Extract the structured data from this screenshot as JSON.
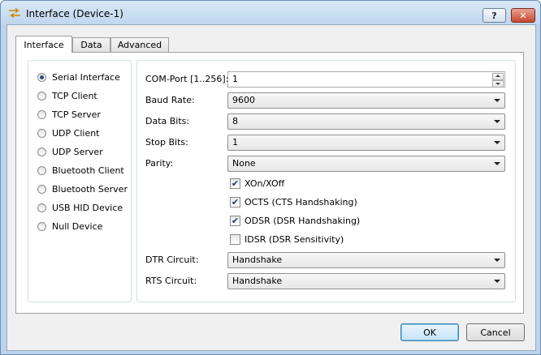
{
  "window": {
    "title": "Interface (Device-1)",
    "help_label": "?",
    "close_label": "✕"
  },
  "tabs": [
    {
      "label": "Interface",
      "active": true
    },
    {
      "label": "Data",
      "active": false
    },
    {
      "label": "Advanced",
      "active": false
    }
  ],
  "interfaces": {
    "selected": "Serial Interface",
    "items": [
      {
        "label": "Serial Interface"
      },
      {
        "label": "TCP Client"
      },
      {
        "label": "TCP Server"
      },
      {
        "label": "UDP Client"
      },
      {
        "label": "UDP Server"
      },
      {
        "label": "Bluetooth Client"
      },
      {
        "label": "Bluetooth Server"
      },
      {
        "label": "USB HID Device"
      },
      {
        "label": "Null Device"
      }
    ]
  },
  "serial": {
    "com_port": {
      "label": "COM-Port [1..256]:",
      "value": "1"
    },
    "baud_rate": {
      "label": "Baud Rate:",
      "value": "9600"
    },
    "data_bits": {
      "label": "Data Bits:",
      "value": "8"
    },
    "stop_bits": {
      "label": "Stop Bits:",
      "value": "1"
    },
    "parity": {
      "label": "Parity:",
      "value": "None"
    },
    "xon_xoff": {
      "label": "XOn/XOff",
      "checked": true
    },
    "octs": {
      "label": "OCTS (CTS Handshaking)",
      "checked": true
    },
    "odsr": {
      "label": "ODSR (DSR Handshaking)",
      "checked": true
    },
    "idsr": {
      "label": "IDSR (DSR Sensitivity)",
      "checked": false
    },
    "dtr": {
      "label": "DTR Circuit:",
      "value": "Handshake"
    },
    "rts": {
      "label": "RTS Circuit:",
      "value": "Handshake"
    }
  },
  "buttons": {
    "ok": "OK",
    "cancel": "Cancel"
  },
  "colors": {
    "frame": "#bcd3ec",
    "accent": "#3c7fb1",
    "close": "#c8472f"
  }
}
